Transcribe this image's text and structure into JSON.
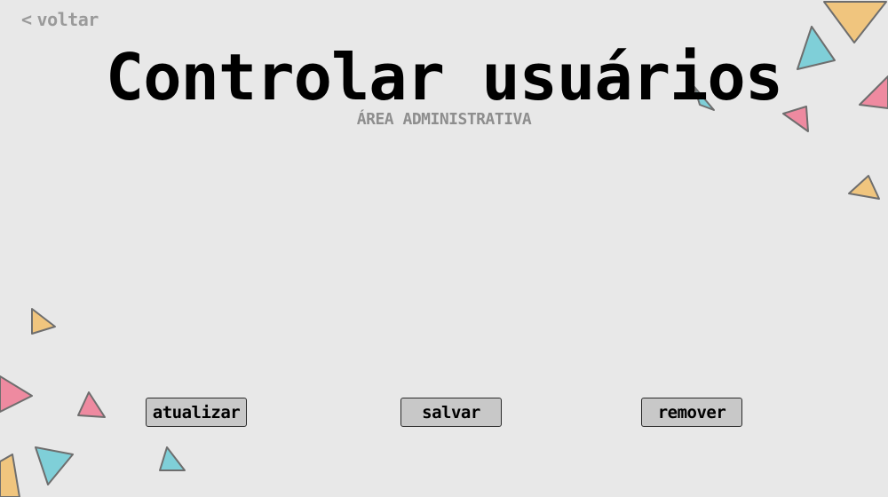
{
  "nav": {
    "back_icon": "chevron-left-icon",
    "back_chevron": "<",
    "back_label": "voltar"
  },
  "header": {
    "title": "Controlar usuários",
    "subtitle": "ÁREA ADMINISTRATIVA"
  },
  "actions": {
    "update_label": "atualizar",
    "save_label": "salvar",
    "remove_label": "remover"
  },
  "colors": {
    "background": "#e8e8e8",
    "triangle_yellow": "#f0c57e",
    "triangle_cyan": "#7fcfd8",
    "triangle_pink": "#ee8aa0",
    "triangle_outline": "#6e6e6e",
    "button_fill": "#c8c8c8",
    "muted_text": "#9a9a9a"
  }
}
